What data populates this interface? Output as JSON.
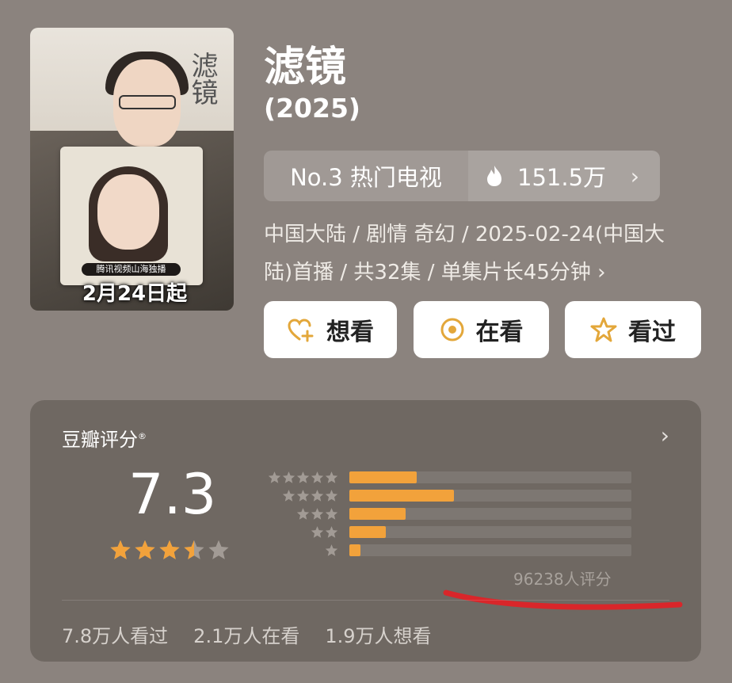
{
  "poster": {
    "calligraphy": "滤镜",
    "badge": "腾讯视频山海独播",
    "date": "2月24日起"
  },
  "header": {
    "title": "滤镜",
    "year": "(2025)",
    "rank": "No.3 热门电视",
    "heat": "151.5万",
    "chevron": "›"
  },
  "meta": {
    "line1": "中国大陆 / 剧情 奇幻 / 2025-02-24(中国大",
    "line2": "陆)首播 / 共32集 / 单集片长45分钟 ›"
  },
  "actions": {
    "want": "想看",
    "watching": "在看",
    "watched": "看过"
  },
  "rating": {
    "label": "豆瓣评分",
    "reg": "®",
    "score": "7.3",
    "stars": 3.5,
    "distribution": [
      0.24,
      0.37,
      0.2,
      0.13,
      0.04
    ],
    "count": "96238人评分",
    "chevron": "›"
  },
  "stats": {
    "watched": "7.8万人看过",
    "watching": "2.1万人在看",
    "want": "1.9万人想看"
  },
  "colors": {
    "accent": "#f2a23b",
    "underline": "#d9262a"
  }
}
